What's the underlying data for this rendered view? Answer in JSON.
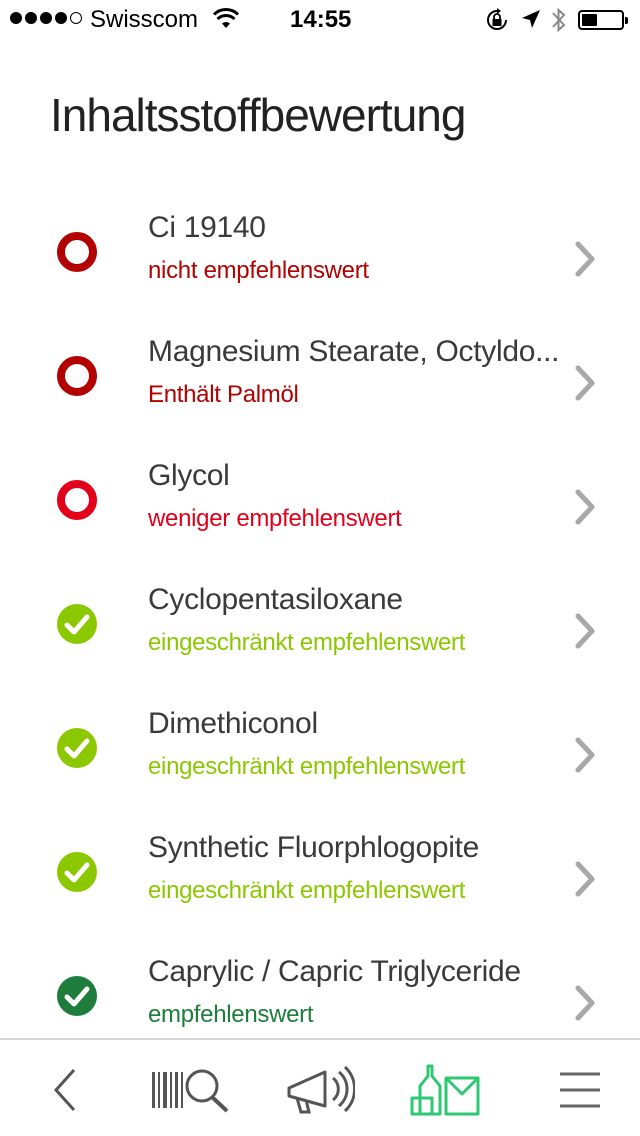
{
  "status_bar": {
    "carrier": "Swisscom",
    "time": "14:55",
    "signal_bars_filled": 4,
    "signal_bars_total": 5,
    "battery_level": 0.4
  },
  "page": {
    "title": "Inhaltsstoffbewertung"
  },
  "colors": {
    "dark_red": "#b30000",
    "red": "#e2001a",
    "light_green": "#8cc800",
    "dark_green": "#1e7d3c",
    "chevron": "#a8a8a8",
    "active_tab": "#2ec872",
    "inactive_tab": "#555555"
  },
  "ingredients": [
    {
      "name": "Ci 19140",
      "rating": "nicht empfehlenswert",
      "icon": "dark-red-ring-icon",
      "color": "#b30000"
    },
    {
      "name": "Magnesium Stearate, Octyldo...",
      "rating": "Enthält Palmöl",
      "icon": "dark-red-ring-icon",
      "color": "#b30000"
    },
    {
      "name": "Glycol",
      "rating": "weniger empfehlenswert",
      "icon": "red-ring-icon",
      "color": "#e2001a"
    },
    {
      "name": "Cyclopentasiloxane",
      "rating": "eingeschränkt empfehlenswert",
      "icon": "light-green-check-icon",
      "color": "#8cc800"
    },
    {
      "name": "Dimethiconol",
      "rating": "eingeschränkt empfehlenswert",
      "icon": "light-green-check-icon",
      "color": "#8cc800"
    },
    {
      "name": "Synthetic Fluorphlogopite",
      "rating": "eingeschränkt empfehlenswert",
      "icon": "light-green-check-icon",
      "color": "#8cc800"
    },
    {
      "name": "Caprylic / Capric Triglyceride",
      "rating": "empfehlenswert",
      "icon": "dark-green-check-icon",
      "color": "#1e7d3c"
    }
  ],
  "tab_bar": {
    "tabs": [
      {
        "name": "back-tab",
        "icon": "chevron-left-icon",
        "active": false
      },
      {
        "name": "scan-tab",
        "icon": "barcode-search-icon",
        "active": false
      },
      {
        "name": "news-tab",
        "icon": "megaphone-icon",
        "active": false
      },
      {
        "name": "products-tab",
        "icon": "products-icon",
        "active": true
      },
      {
        "name": "menu-tab",
        "icon": "hamburger-menu-icon",
        "active": false
      }
    ]
  }
}
